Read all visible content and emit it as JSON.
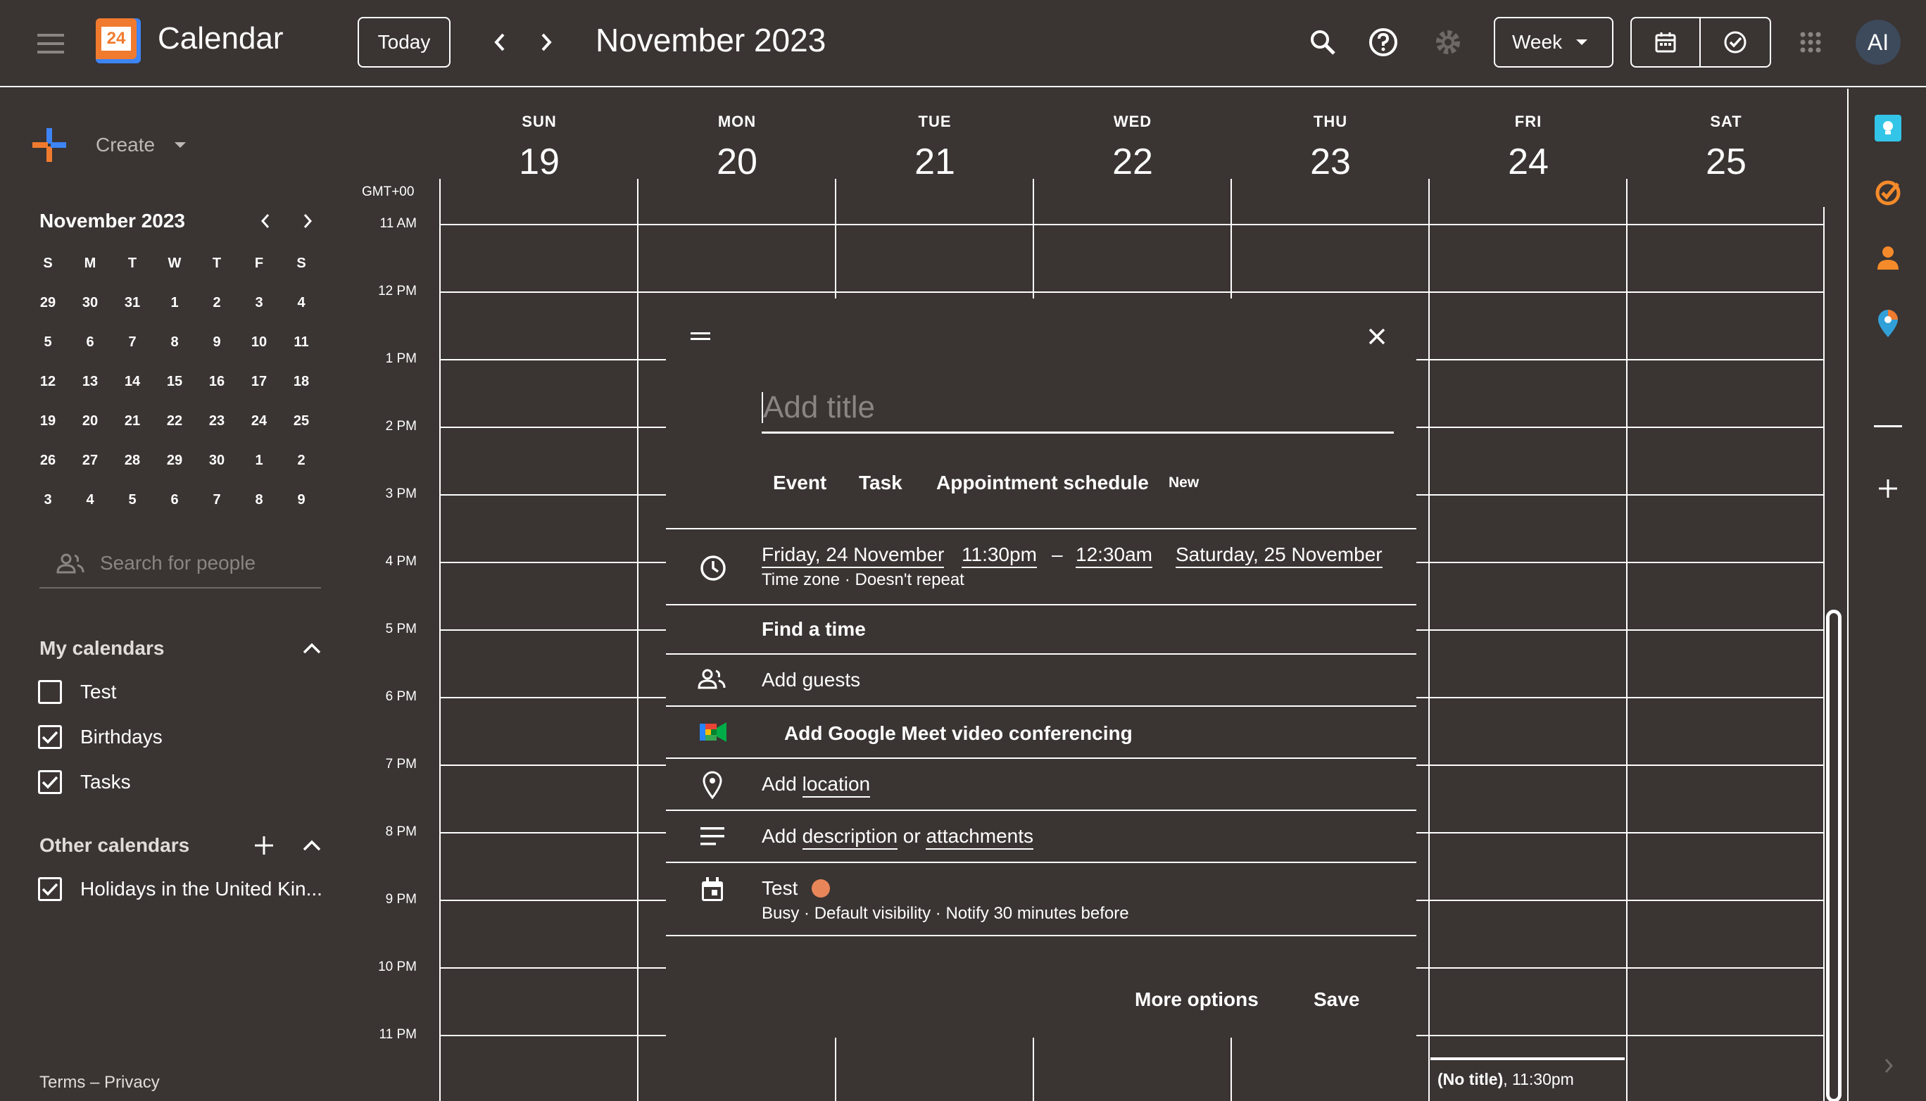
{
  "header": {
    "app_title": "Calendar",
    "logo_day": "24",
    "today_label": "Today",
    "current_period": "November 2023",
    "view_select": "Week",
    "avatar_initials": "AI"
  },
  "sidebar": {
    "create_label": "Create",
    "mini_calendar": {
      "month_label": "November 2023",
      "weekday_headers": [
        "S",
        "M",
        "T",
        "W",
        "T",
        "F",
        "S"
      ],
      "weeks": [
        [
          "29",
          "30",
          "31",
          "1",
          "2",
          "3",
          "4"
        ],
        [
          "5",
          "6",
          "7",
          "8",
          "9",
          "10",
          "11"
        ],
        [
          "12",
          "13",
          "14",
          "15",
          "16",
          "17",
          "18"
        ],
        [
          "19",
          "20",
          "21",
          "22",
          "23",
          "24",
          "25"
        ],
        [
          "26",
          "27",
          "28",
          "29",
          "30",
          "1",
          "2"
        ],
        [
          "3",
          "4",
          "5",
          "6",
          "7",
          "8",
          "9"
        ]
      ]
    },
    "search_people_placeholder": "Search for people",
    "my_calendars_label": "My calendars",
    "my_calendars": [
      {
        "label": "Test",
        "checked": false
      },
      {
        "label": "Birthdays",
        "checked": true
      },
      {
        "label": "Tasks",
        "checked": true
      }
    ],
    "other_calendars_label": "Other calendars",
    "other_calendars": [
      {
        "label": "Holidays in the United Kin...",
        "checked": true
      }
    ],
    "footer_terms": "Terms",
    "footer_dash": "–",
    "footer_privacy": "Privacy"
  },
  "week": {
    "timezone_label": "GMT+00",
    "days": [
      {
        "name": "SUN",
        "date": "19"
      },
      {
        "name": "MON",
        "date": "20"
      },
      {
        "name": "TUE",
        "date": "21"
      },
      {
        "name": "WED",
        "date": "22"
      },
      {
        "name": "THU",
        "date": "23"
      },
      {
        "name": "FRI",
        "date": "24"
      },
      {
        "name": "SAT",
        "date": "25"
      }
    ],
    "hours": [
      "11 AM",
      "12 PM",
      "1 PM",
      "2 PM",
      "3 PM",
      "4 PM",
      "5 PM",
      "6 PM",
      "7 PM",
      "8 PM",
      "9 PM",
      "10 PM",
      "11 PM"
    ],
    "draft_event_title": "(No title)",
    "draft_event_time": ", 11:30pm"
  },
  "event_modal": {
    "title_placeholder": "Add title",
    "tabs": [
      "Event",
      "Task",
      "Appointment schedule"
    ],
    "new_badge": "New",
    "start_date": "Friday, 24 November",
    "start_time": "11:30pm",
    "dash": "–",
    "end_time": "12:30am",
    "end_date": "Saturday, 25 November",
    "timezone_link": "Time zone",
    "dot": "·",
    "repeat": "Doesn't repeat",
    "find_time": "Find a time",
    "add_guests": "Add guests",
    "meet": "Add Google Meet video conferencing",
    "add_word": "Add",
    "location_link": "location",
    "description_link": "description",
    "or_word": "or",
    "attachments_link": "attachments",
    "calendar_name": "Test",
    "calendar_color": "#e8865a",
    "busy": "Busy",
    "visibility": "Default visibility",
    "notify": "Notify 30 minutes before",
    "more_options": "More options",
    "save": "Save"
  },
  "colors": {
    "background": "#3a3432",
    "logo_orange": "#f07b2e",
    "logo_blue": "#3d84f5",
    "keep_yellow": "#32c5e8",
    "tasks_orange": "#f58a2a"
  }
}
